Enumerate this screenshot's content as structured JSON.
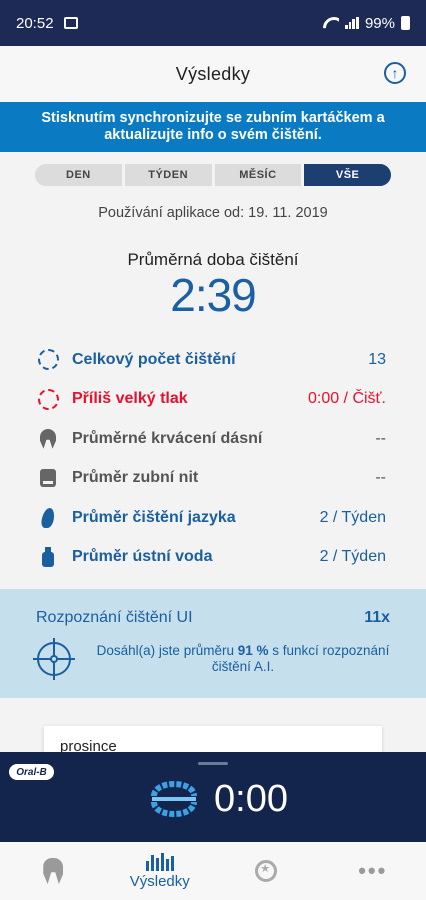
{
  "status_bar": {
    "time": "20:52",
    "battery": "99%"
  },
  "header": {
    "title": "Výsledky"
  },
  "banner": {
    "text": "Stisknutím synchronizujte se zubním kartáčkem a aktualizujte info o svém čištění."
  },
  "segments": [
    {
      "label": "DEN",
      "active": false
    },
    {
      "label": "TÝDEN",
      "active": false
    },
    {
      "label": "MĚSÍC",
      "active": false
    },
    {
      "label": "VŠE",
      "active": true
    }
  ],
  "since_text": "Používání aplikace od: 19. 11. 2019",
  "average": {
    "label": "Průměrná doba čištění",
    "value": "2:39"
  },
  "stats": [
    {
      "icon": "dashed-circle-icon",
      "label": "Celkový počet čištění",
      "value": "13",
      "color": "#1a5fa0"
    },
    {
      "icon": "pressure-circle-icon",
      "label": "Příliš velký tlak",
      "value": "0:00 / Čišť.",
      "color": "#e8112d"
    },
    {
      "icon": "tooth-icon",
      "label": "Průměrné krvácení dásní",
      "value": "--",
      "color": "#555555"
    },
    {
      "icon": "floss-icon",
      "label": "Průměr zubní nit",
      "value": "--",
      "color": "#555555"
    },
    {
      "icon": "tongue-icon",
      "label": "Průměr čištění jazyka",
      "value": "2 / Týden",
      "color": "#1a5fa0"
    },
    {
      "icon": "mouthwash-icon",
      "label": "Průměr ústní voda",
      "value": "2 / Týden",
      "color": "#1a5fa0"
    }
  ],
  "ai": {
    "title": "Rozpoznání čištění UI",
    "count": "11x",
    "text_before": "Dosáhl(a) jste průměru ",
    "percent": "91 %",
    "text_after": " s funkcí rozpoznání čištění A.I."
  },
  "card": {
    "month": "prosince"
  },
  "player": {
    "brand": "Oral-B",
    "timer": "0:00"
  },
  "bottom_nav": [
    {
      "icon": "tooth-icon",
      "label": ""
    },
    {
      "icon": "bar-chart-icon",
      "label": "Výsledky"
    },
    {
      "icon": "badge-icon",
      "label": ""
    },
    {
      "icon": "more-icon",
      "label": ""
    }
  ]
}
